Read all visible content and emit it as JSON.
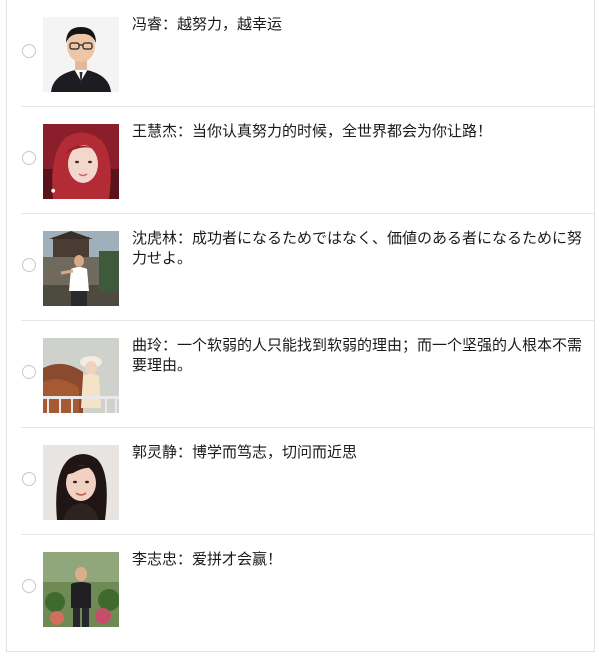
{
  "list": {
    "items": [
      {
        "name": "冯睿",
        "separator": "：",
        "quote": "越努力，越幸运",
        "selected": false,
        "avatar_icon": "man-suit-portrait"
      },
      {
        "name": "王慧杰",
        "separator": "：",
        "quote": "当你认真努力的时候，全世界都会为你让路！",
        "selected": false,
        "avatar_icon": "woman-red-hair-portrait"
      },
      {
        "name": "沈虎林",
        "separator": "：",
        "quote": "成功者になるためではなく、価値のある者になるために努力せよ。",
        "selected": false,
        "avatar_icon": "man-outdoor-photo"
      },
      {
        "name": "曲玲",
        "separator": "：",
        "quote": "一个软弱的人只能找到软弱的理由；而一个坚强的人根本不需要理由。",
        "selected": false,
        "avatar_icon": "woman-hat-outdoor-photo"
      },
      {
        "name": "郭灵静",
        "separator": "：",
        "quote": "博学而笃志，切问而近思",
        "selected": false,
        "avatar_icon": "woman-portrait"
      },
      {
        "name": "李志忠",
        "separator": "：",
        "quote": "爱拼才会赢！",
        "selected": false,
        "avatar_icon": "man-garden-photo"
      }
    ]
  },
  "colors": {
    "separator": "#e6e6e6",
    "radio_border": "#c8c8c8",
    "text": "#1a1a1a"
  }
}
